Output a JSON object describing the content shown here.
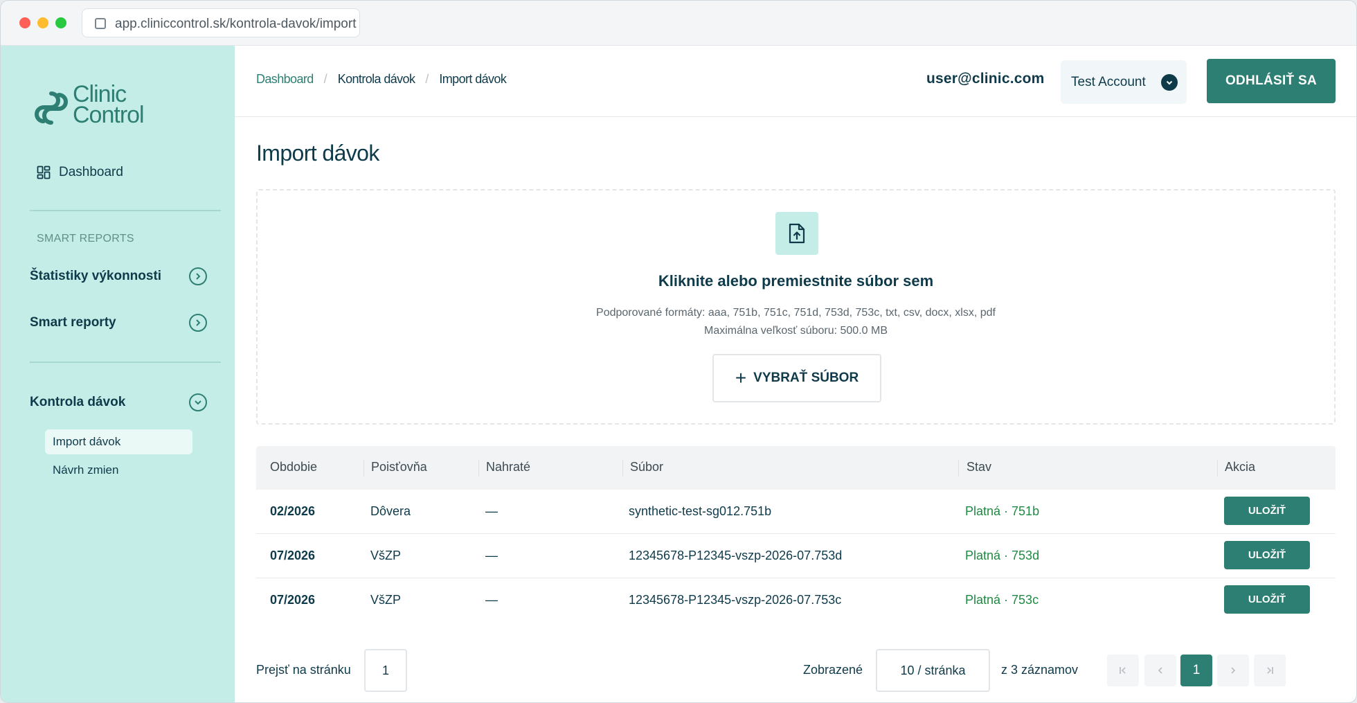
{
  "browser": {
    "url": "app.cliniccontrol.sk/kontrola-davok/import"
  },
  "sidebar": {
    "logo_line1": "Clinic",
    "logo_line2": "Control",
    "dashboard_label": "Dashboard",
    "section_label": "SMART REPORTS",
    "groups": [
      {
        "label": "Štatistiky výkonnosti",
        "state": "collapsed"
      },
      {
        "label": "Smart reporty",
        "state": "collapsed"
      },
      {
        "label": "Kontrola dávok",
        "state": "expanded"
      }
    ],
    "sub_items": [
      {
        "label": "Import dávok",
        "active": true
      },
      {
        "label": "Návrh zmien",
        "active": false
      }
    ]
  },
  "header": {
    "breadcrumbs": [
      "Dashboard",
      "Kontrola dávok",
      "Import dávok"
    ],
    "user_email": "user@clinic.com",
    "account_label": "Test Account",
    "logout_label": "ODHLÁSIŤ SA"
  },
  "main": {
    "title": "Import dávok",
    "dropzone": {
      "title": "Kliknite alebo premiestnite súbor sem",
      "formats": "Podporované formáty: aaa, 751b, 751c, 751d, 753d, 753c, txt, csv, docx, xlsx, pdf",
      "max_size": "Maximálna veľkosť súboru: 500.0 MB",
      "button_label": "VYBRAŤ SÚBOR"
    },
    "table": {
      "columns": [
        "Obdobie",
        "Poisťovňa",
        "Nahraté",
        "Súbor",
        "Stav",
        "Akcia"
      ],
      "rows": [
        {
          "period": "02/2026",
          "insurer": "Dôvera",
          "uploaded": "—",
          "file": "synthetic-test-sg012.751b",
          "status": "Platná · 751b",
          "action": "ULOŽIŤ"
        },
        {
          "period": "07/2026",
          "insurer": "VšZP",
          "uploaded": "—",
          "file": "12345678-P12345-vszp-2026-07.753d",
          "status": "Platná · 753d",
          "action": "ULOŽIŤ"
        },
        {
          "period": "07/2026",
          "insurer": "VšZP",
          "uploaded": "—",
          "file": "12345678-P12345-vszp-2026-07.753c",
          "status": "Platná · 753c",
          "action": "ULOŽIŤ"
        }
      ]
    },
    "pagination": {
      "goto_label": "Prejsť na stránku",
      "goto_value": "1",
      "shown_label": "Zobrazené",
      "page_size": "10 / stránka",
      "total_label": "z 3 záznamov",
      "current_page": "1"
    }
  },
  "colors": {
    "brand": "#2d7f73",
    "sidebar_bg": "#c5ede8",
    "text_dark": "#0e3a4a",
    "status_ok": "#1f8a43"
  }
}
